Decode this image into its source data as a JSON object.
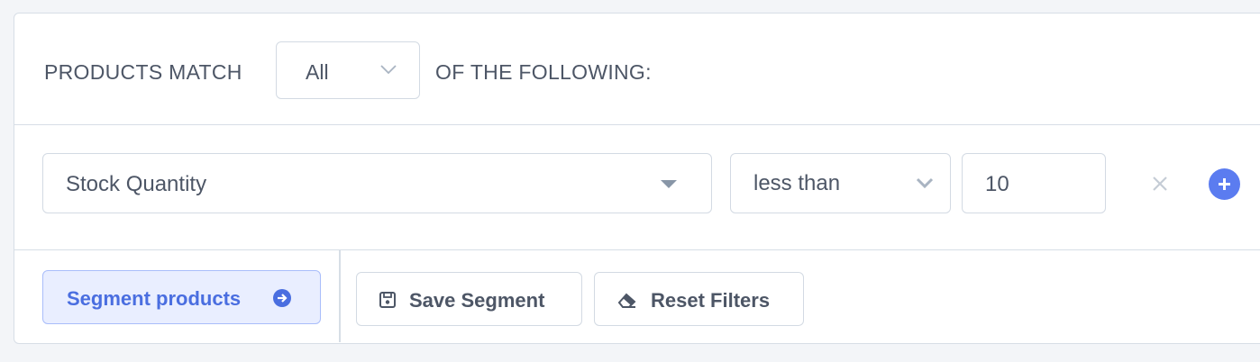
{
  "match_row": {
    "prefix": "PRODUCTS MATCH",
    "selected": "All",
    "suffix": "OF THE FOLLOWING:"
  },
  "filter_row": {
    "field": "Stock Quantity",
    "operator": "less than",
    "value": "10"
  },
  "actions": {
    "segment_label": "Segment products",
    "save_label": "Save Segment",
    "reset_label": "Reset Filters"
  },
  "colors": {
    "accent": "#5b7cf0",
    "primary_bg": "#e9eeff",
    "border": "#d3dae3",
    "text": "#4d5666"
  },
  "icons": {
    "segment": "arrow-circle-right-icon",
    "save": "floppy-disk-icon",
    "reset": "eraser-icon",
    "remove": "close-icon",
    "add": "plus-circle-icon"
  }
}
